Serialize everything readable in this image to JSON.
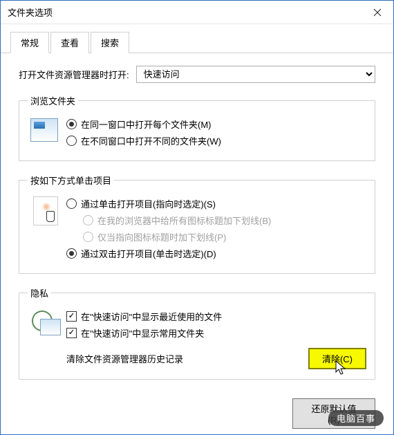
{
  "window": {
    "title": "文件夹选项"
  },
  "tabs": {
    "general": "常规",
    "view": "查看",
    "search": "搜索"
  },
  "openWith": {
    "label": "打开文件资源管理器时打开:",
    "selected": "快速访问"
  },
  "browse": {
    "legend": "浏览文件夹",
    "sameWindow": "在同一窗口中打开每个文件夹(M)",
    "newWindow": "在不同窗口中打开不同的文件夹(W)"
  },
  "click": {
    "legend": "按如下方式单击项目",
    "single": "通过单击打开项目(指向时选定)(S)",
    "underlineAll": "在我的浏览器中给所有图标标题加下划线(B)",
    "underlinePoint": "仅当指向图标标题时加下划线(P)",
    "double": "通过双击打开项目(单击时选定)(D)"
  },
  "privacy": {
    "legend": "隐私",
    "showRecent": "在\"快速访问\"中显示最近使用的文件",
    "showFrequent": "在\"快速访问\"中显示常用文件夹",
    "clearLabel": "清除文件资源管理器历史记录",
    "clearBtn": "清除(C)"
  },
  "footer": {
    "restore": "还原默认值(R)"
  },
  "watermark": "电脑百事"
}
